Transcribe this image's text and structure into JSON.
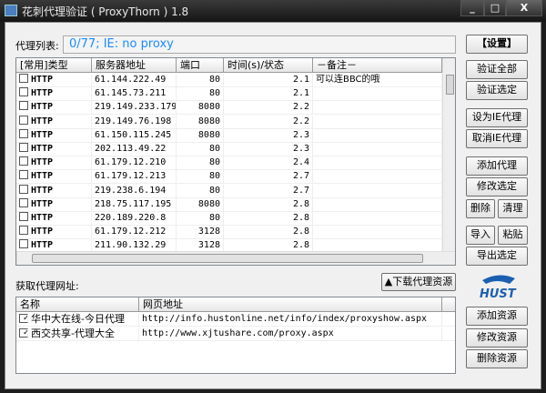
{
  "window": {
    "title": "花刺代理验证 ( ProxyThorn ) 1.8",
    "min": "_",
    "max": "□",
    "close": "X"
  },
  "proxy_list": {
    "label": "代理列表:",
    "status": "0/77;   IE: no proxy"
  },
  "columns": [
    "[常用]类型",
    "服务器地址",
    "端口",
    "时间(s)/状态",
    "－备注－"
  ],
  "rows": [
    [
      "HTTP",
      "61.144.222.49",
      "80",
      "2.1",
      "可以连BBC的哦"
    ],
    [
      "HTTP",
      "61.145.73.211",
      "80",
      "2.1",
      ""
    ],
    [
      "HTTP",
      "219.149.233.179",
      "8080",
      "2.2",
      ""
    ],
    [
      "HTTP",
      "219.149.76.198",
      "8080",
      "2.2",
      ""
    ],
    [
      "HTTP",
      "61.150.115.245",
      "8080",
      "2.3",
      ""
    ],
    [
      "HTTP",
      "202.113.49.22",
      "80",
      "2.3",
      ""
    ],
    [
      "HTTP",
      "61.179.12.210",
      "80",
      "2.4",
      ""
    ],
    [
      "HTTP",
      "61.179.12.213",
      "80",
      "2.7",
      ""
    ],
    [
      "HTTP",
      "219.238.6.194",
      "80",
      "2.7",
      ""
    ],
    [
      "HTTP",
      "218.75.117.195",
      "8080",
      "2.8",
      ""
    ],
    [
      "HTTP",
      "220.189.220.8",
      "80",
      "2.8",
      ""
    ],
    [
      "HTTP",
      "61.179.12.212",
      "3128",
      "2.8",
      ""
    ],
    [
      "HTTP",
      "211.90.132.29",
      "3128",
      "2.8",
      ""
    ]
  ],
  "buttons": {
    "settings": "【设置】",
    "verify_all": "验证全部",
    "verify_selected": "验证选定",
    "set_ie": "设为IE代理",
    "cancel_ie": "取消IE代理",
    "add_proxy": "添加代理",
    "edit_selected": "修改选定",
    "delete": "删除",
    "clean": "清理",
    "import": "导入",
    "paste": "粘贴",
    "export_selected": "导出选定",
    "add_source": "添加资源",
    "edit_source": "修改资源",
    "delete_source": "删除资源",
    "download": "▲下载代理资源"
  },
  "sources": {
    "label": "获取代理网址:",
    "columns": [
      "名称",
      "网页地址"
    ],
    "rows": [
      [
        "华中大在线-今日代理",
        "http://info.hustonline.net/info/index/proxyshow.aspx"
      ],
      [
        "西交共享-代理大全",
        "http://www.xjtushare.com/proxy.aspx"
      ]
    ]
  },
  "logo": "HUST"
}
